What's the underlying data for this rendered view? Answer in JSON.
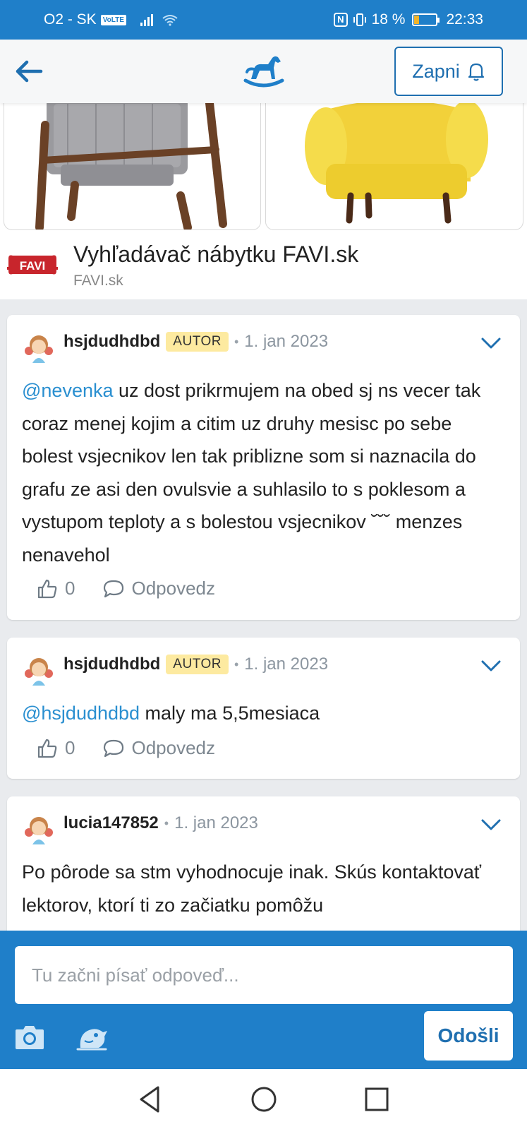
{
  "status_bar": {
    "carrier": "O2 - SK",
    "volte": "VoLTE",
    "nfc": "N",
    "battery": "18 %",
    "battery_level": 0.18,
    "time": "22:33"
  },
  "header": {
    "subscribe_label": "Zapni"
  },
  "ad": {
    "logo_text": "FAVI",
    "title": "Vyhľadávač nábytku FAVI.sk",
    "source": "FAVI.sk"
  },
  "comments": [
    {
      "username": "hsjdudhdbd",
      "badge": "AUTOR",
      "dot": "•",
      "date": "1. jan 2023",
      "mention": "@nevenka",
      "text": " uz dost prikrmujem na obed sj ns vecer tak coraz menej kojim a citim uz druhy mesisc po sebe bolest vsjecnikov len tak priblizne som si naznacila do grafu ze asi den ovulsvie a suhlasilo to s poklesom a vystupom teploty a s bolestou vsjecnikov ˘˘˘ menzes nenavehol",
      "likes": "0",
      "reply_label": "Odpovedz"
    },
    {
      "username": "hsjdudhdbd",
      "badge": "AUTOR",
      "dot": "•",
      "date": "1. jan 2023",
      "mention": "@hsjdudhdbd",
      "text": " maly ma 5,5mesiaca",
      "likes": "0",
      "reply_label": "Odpovedz"
    },
    {
      "username": "lucia147852",
      "dot": "•",
      "date": "1. jan 2023",
      "text": "Po pôrode sa stm vyhodnocuje inak. Skús kontaktovať lektorov, ktorí ti zo začiatku pomôžu"
    }
  ],
  "reply_bar": {
    "placeholder": "Tu začni písať odpoveď...",
    "send_label": "Odošli"
  },
  "colors": {
    "brand_blue": "#1f7fc9",
    "link_blue": "#2a8fd0",
    "badge_yellow": "#fdeaa0",
    "favi_red": "#c8252c"
  }
}
